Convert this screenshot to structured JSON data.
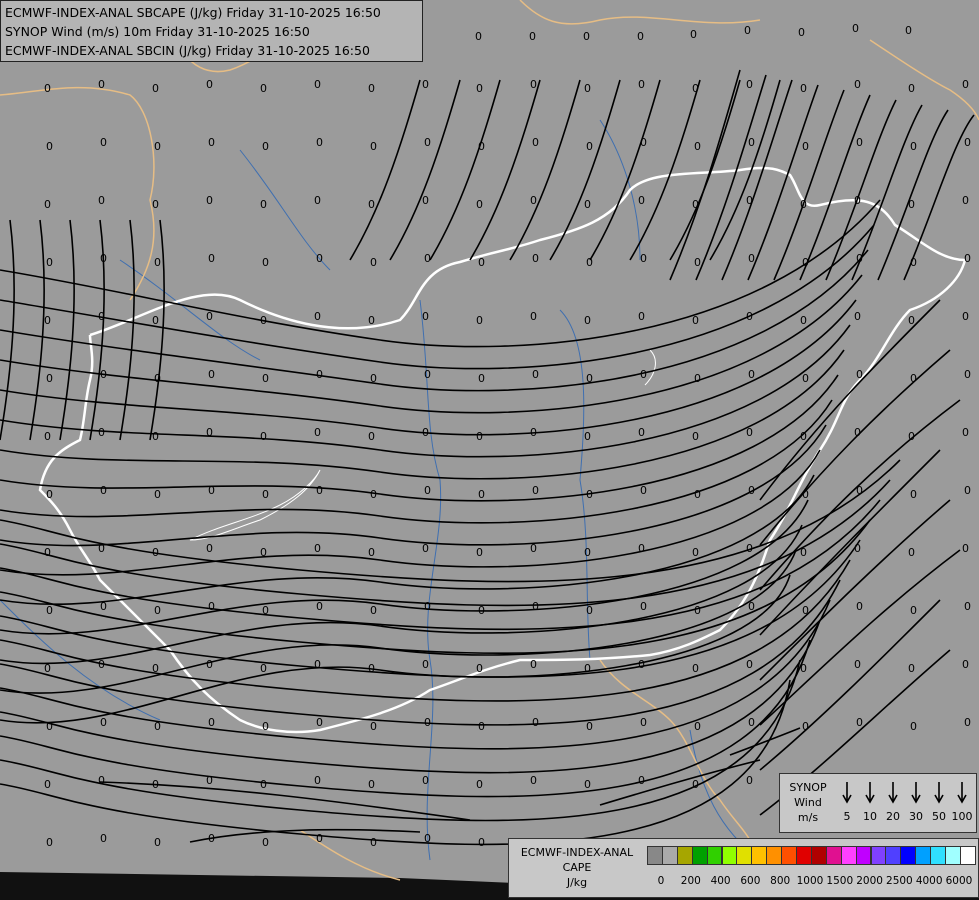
{
  "title": {
    "line1": "ECMWF-INDEX-ANAL SBCAPE (J/kg) Friday 31-10-2025 16:50",
    "line2": "SYNOP Wind (m/s) 10m Friday 31-10-2025 16:50",
    "line3": "ECMWF-INDEX-ANAL SBCIN (J/kg) Friday 31-10-2025 16:50"
  },
  "grid_value": "0",
  "colors": {
    "background": "#9b9b9b",
    "country_border": "#e6bd85",
    "hungary_border": "#ffffff",
    "rivers": "#3f6fb0",
    "streamlines": "#000000"
  },
  "wind_legend": {
    "line1": "SYNOP",
    "line2": "Wind",
    "line3": "m/s",
    "values": [
      "5",
      "10",
      "20",
      "30",
      "50",
      "100"
    ]
  },
  "cape_legend": {
    "line1": "ECMWF-INDEX-ANAL",
    "line2": "CAPE",
    "line3": "J/kg",
    "labels": [
      "0",
      "200",
      "400",
      "600",
      "800",
      "1000",
      "1500",
      "2000",
      "2500",
      "4000",
      "6000"
    ],
    "swatches": [
      "#888888",
      "#aaaaaa",
      "#a6a600",
      "#00a000",
      "#30d000",
      "#90ff00",
      "#e0e000",
      "#ffc000",
      "#ff9000",
      "#ff5000",
      "#e00000",
      "#b00000",
      "#e01090",
      "#ff40ff",
      "#c000ff",
      "#8040ff",
      "#5040ff",
      "#0000ff",
      "#00a0ff",
      "#30e0ff",
      "#a0ffff",
      "#ffffff"
    ]
  }
}
